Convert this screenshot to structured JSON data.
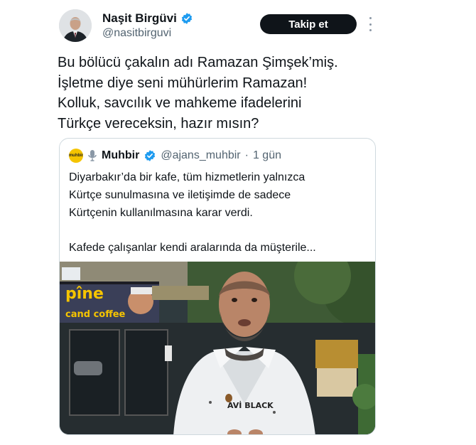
{
  "tweet": {
    "author_name": "Naşit Birgüvi",
    "author_handle": "@nasitbirguvi",
    "follow_label": "Takip et",
    "text_lines": [
      "Bu bölücü çakalın adı Ramazan Şimşek’miş.",
      "İşletme diye seni mühürlerim Ramazan!",
      "Kolluk, savcılık ve mahkeme ifadelerini",
      "Türkçe vereceksin, hazır mısın?"
    ]
  },
  "quoted": {
    "author_name": "Muhbir",
    "author_handle": "@ajans_muhbir",
    "separator": "·",
    "time": "1 gün",
    "logo_text": "muhbir",
    "text_lines": [
      "Diyarbakır’da bir kafe, tüm hizmetlerin yalnızca",
      "Kürtçe sunulmasına ve iletişimde de sadece",
      "Kürtçenin kullanılmasına karar verdi."
    ],
    "text_line_last": "Kafede çalışanlar kendi aralarında da  müşterile...",
    "media": {
      "sign_top": "pîne",
      "sign_bottom": "cand coffee",
      "shirt_text": "AVİ BLACK"
    }
  },
  "colors": {
    "verified": "#1d9bf0",
    "follow_bg": "#0f1419",
    "secondary_text": "#536471",
    "border": "#cfd9de"
  },
  "icons": {
    "verified": "verified-badge-icon",
    "more": "more-dots-icon",
    "microphone": "microphone-icon"
  }
}
